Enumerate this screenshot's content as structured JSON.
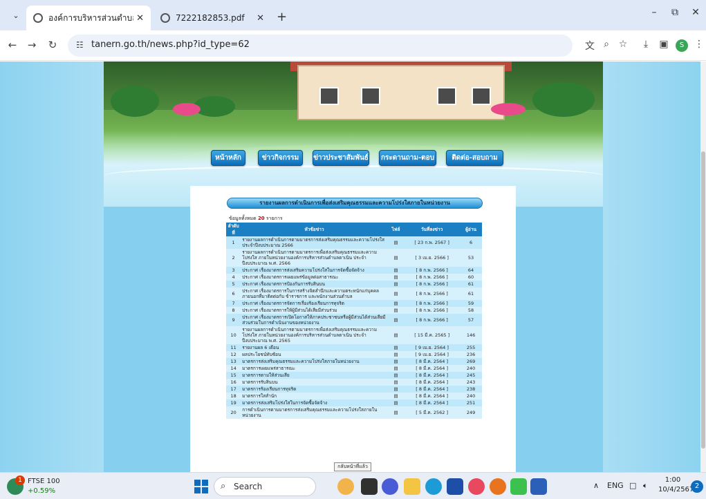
{
  "browser": {
    "tabs": [
      {
        "title": "องค์การบริหารส่วนตำบลตาเนิน อำเภ",
        "active": true
      },
      {
        "title": "7222182853.pdf",
        "active": false
      }
    ],
    "url": "tanern.go.th/news.php?id_type=62",
    "profile_initial": "S"
  },
  "site": {
    "nav": [
      "หน้าหลัก",
      "ข่าวกิจกรรม",
      "ข่าวประชาสัมพันธ์",
      "กระดานถาม-ตอบ",
      "ติดต่อ-สอบถาม"
    ],
    "page_heading": "รายงานผลการดำเนินการเพื่อส่งเสริมคุณธรรมและความโปร่งใสภายในหน่วยงาน",
    "total_prefix": "ข้อมูลทั้งหมด",
    "total_count": "20",
    "total_suffix": "รายการ",
    "columns": [
      "ลำดับที่",
      "หัวข้อข่าว",
      "ไฟล์",
      "วันที่ลงข่าว",
      "ผู้อ่าน"
    ],
    "rows": [
      {
        "no": "1",
        "title": "รายงานผลการดำเนินการตามมาตรการส่งเสริมคุณธรรมและความโปร่งใส ประจำปีงบประมาณ 2566",
        "date": "[ 23 ก.พ. 2567 ]",
        "views": "6"
      },
      {
        "no": "2",
        "title": "รายงานผลการดำเนินการตามมาตรการเพื่อส่งเสริมคุณธรรมและความโปร่งใส ภายในหน่วยงานองค์การบริหารส่วนตำบลตาเนิน ประจำปีงบประมาณ พ.ศ. 2566",
        "date": "[ 3 เม.ย. 2566 ]",
        "views": "53"
      },
      {
        "no": "3",
        "title": "ประกาศ เรื่องมาตรการส่งเสริมความโปร่งใสในการจัดซื้อจัดจ้าง",
        "date": "[ 8 ก.พ. 2566 ]",
        "views": "64"
      },
      {
        "no": "4",
        "title": "ประกาศ เรื่องมาตรการเผยแพร่ข้อมูลต่อสาธารณะ",
        "date": "[ 8 ก.พ. 2566 ]",
        "views": "60"
      },
      {
        "no": "5",
        "title": "ประกาศ เรื่องมาตรการป้องกันการรับสินบน",
        "date": "[ 8 ก.พ. 2566 ]",
        "views": "61"
      },
      {
        "no": "6",
        "title": "ประกาศ เรื่องมาตรการในการสร้างจิตสำนึกและความตระหนักแก่บุคคลภายนอกที่มาติดต่อกับ ข้าราชการ และพนักงานส่วนตำบล",
        "date": "[ 8 ก.พ. 2566 ]",
        "views": "61"
      },
      {
        "no": "7",
        "title": "ประกาศ เรื่องมาตรการจัดการเรื่องร้องเรียนการทุจริต",
        "date": "[ 8 ก.พ. 2566 ]",
        "views": "59"
      },
      {
        "no": "8",
        "title": "ประกาศ เรื่องมาตรการให้ผู้มีส่วนได้เสียมีส่วนร่วม",
        "date": "[ 8 ก.พ. 2566 ]",
        "views": "58"
      },
      {
        "no": "9",
        "title": "ประกาศ เรื่องมาตรการเปิดโอกาสให้ภาคประชาชนหรือผู้มีส่วนได้ส่วนเสียมีส่วนร่วมในการดำเนินงานของหน่วยงาน",
        "date": "[ 8 ก.พ. 2566 ]",
        "views": "57"
      },
      {
        "no": "10",
        "title": "รายงานผลการดำเนินการตามมาตรการเพื่อส่งเสริมคุณธรรมและความโปร่งใส ภายในหน่วยงานองค์การบริหารส่วนตำบลตาเนิน ประจำปีงบประมาณ พ.ศ. 2565",
        "date": "[ 15 มี.ค. 2565 ]",
        "views": "146"
      },
      {
        "no": "11",
        "title": "รายงานผล 6 เดือน",
        "date": "[ 9 เม.ย. 2564 ]",
        "views": "255"
      },
      {
        "no": "12",
        "title": "ผลประโยชน์ทับซ้อน",
        "date": "[ 9 เม.ย. 2564 ]",
        "views": "236"
      },
      {
        "no": "13",
        "title": "มาตรการส่งเสริมคุณธรรมและความโปร่งใสภายในหน่วยงาน",
        "date": "[ 8 มี.ค. 2564 ]",
        "views": "269"
      },
      {
        "no": "14",
        "title": "มาตรการเผยแพร่สาธารณะ",
        "date": "[ 8 มี.ค. 2564 ]",
        "views": "240"
      },
      {
        "no": "15",
        "title": "มาตรการตามให้ส่วนเสีย",
        "date": "[ 8 มี.ค. 2564 ]",
        "views": "245"
      },
      {
        "no": "16",
        "title": "มาตรการรับสินบน",
        "date": "[ 8 มี.ค. 2564 ]",
        "views": "243"
      },
      {
        "no": "17",
        "title": "มาตรการร้องเรียนการทุจริต",
        "date": "[ 8 มี.ค. 2564 ]",
        "views": "238"
      },
      {
        "no": "18",
        "title": "มาตรการใสสำนัก",
        "date": "[ 8 มี.ค. 2564 ]",
        "views": "240"
      },
      {
        "no": "19",
        "title": "มาตรการส่งเสริมโปร่งใสในการจัดซื้อจัดจ้าง",
        "date": "[ 8 มี.ค. 2564 ]",
        "views": "251"
      },
      {
        "no": "20",
        "title": "การดำเนินการตามมาตรการส่งเสริมคุณธรรมและความโปร่งใสภายในหน่วยงาน",
        "date": "[ 5 มี.ค. 2562 ]",
        "views": "249"
      }
    ],
    "back_label": "กลับหน้าที่แล้ว"
  },
  "taskbar": {
    "stock_name": "FTSE 100",
    "stock_change": "+0.59%",
    "stock_badge": "1",
    "search_label": "Search",
    "lang": "ENG",
    "time": "1:00",
    "date": "10/4/2567",
    "notif_count": "2"
  }
}
